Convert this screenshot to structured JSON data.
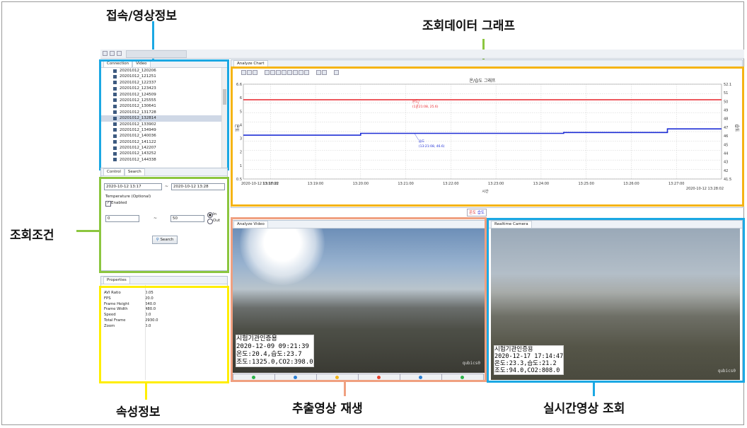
{
  "callouts": {
    "connection": "접속/영상정보",
    "chart": "조회데이터 그래프",
    "conditions": "조회조건",
    "properties": "속성정보",
    "playback": "추출영상 재생",
    "realtime": "실시간영상 조회"
  },
  "colors": {
    "callout_blue": "#1ba8e3",
    "callout_green": "#8cc63f",
    "callout_orange": "#f5b414",
    "callout_yellow": "#ffee00",
    "callout_salmon": "#f0a080",
    "series_temp": "#e8242a",
    "series_humid": "#1f2fd6"
  },
  "connection_panel": {
    "tabs": [
      "Connection",
      "Video"
    ],
    "items": [
      "20201012_120206",
      "20201012_121251",
      "20201012_122337",
      "20201012_123423",
      "20201012_124509",
      "20201012_125555",
      "20201012_130641",
      "20201012_131728",
      "20201012_132814",
      "20201012_133902",
      "20201012_134949",
      "20201012_140036",
      "20201012_141122",
      "20201012_142207",
      "20201012_143252",
      "20201012_144338"
    ],
    "selected_index": 8
  },
  "control_panel": {
    "tabs": [
      "Control",
      "Search"
    ],
    "date_from": "2020-10-12 13:17",
    "date_sep": "~",
    "date_to": "2020-10-12 13:28",
    "temp_label": "Temperature (Optional)",
    "enabled_label": "Enabled",
    "min_value": "0",
    "range_sep": "~",
    "max_value": "50",
    "radio_in": "In",
    "radio_out": "Out",
    "search_label": "Search"
  },
  "properties_panel": {
    "title": "Properties",
    "rows": [
      {
        "key": "AVI Ratio",
        "value": "0.05"
      },
      {
        "key": "FPS",
        "value": "20.0"
      },
      {
        "key": "Frame Height",
        "value": "640.0"
      },
      {
        "key": "Frame Width",
        "value": "480.0"
      },
      {
        "key": "Speed",
        "value": "0.0"
      },
      {
        "key": "Total Frame",
        "value": "2930.0"
      },
      {
        "key": "Zoom",
        "value": "0.0"
      }
    ]
  },
  "chart_panel": {
    "tab": "Analyze Chart"
  },
  "chart_data": {
    "type": "line",
    "title": "온/습도 그래프",
    "x_start_label": "2020-10-12 13:17:22",
    "x_end_label": "2020-10-12 13:28:02",
    "x": [
      "13:18:00",
      "13:19:00",
      "13:20:00",
      "13:21:00",
      "13:22:00",
      "13:23:00",
      "13:24:00",
      "13:25:00",
      "13:26:00",
      "13:27:00"
    ],
    "ylim": [
      0.5,
      6.6
    ],
    "y_ticks": [
      "6.6",
      "6",
      "5",
      "4",
      "3",
      "2",
      "1",
      "0.5"
    ],
    "y2lim": [
      41.5,
      52.1
    ],
    "y2_ticks": [
      "52.1",
      "51",
      "50",
      "49",
      "48",
      "47",
      "46",
      "45",
      "44",
      "43",
      "42",
      "41.5"
    ],
    "ylabel": "온도",
    "y2label": "습도",
    "xlabel": "시간",
    "grid": true,
    "series": [
      {
        "name": "온도",
        "axis": "left",
        "points": [
          [
            0,
            5.6
          ],
          [
            3.7,
            5.6
          ],
          [
            3.7,
            5.6
          ],
          [
            10.6,
            5.6
          ]
        ]
      },
      {
        "name": "습도",
        "axis": "right",
        "points": [
          [
            0,
            46.4
          ],
          [
            2.6,
            46.4
          ],
          [
            2.6,
            46.6
          ],
          [
            7.1,
            46.6
          ],
          [
            7.1,
            46.7
          ],
          [
            9.4,
            46.7
          ],
          [
            9.4,
            47.1
          ],
          [
            10.6,
            47.1
          ]
        ]
      }
    ],
    "annotations": [
      {
        "label": "온도",
        "text": "(13:21:08, 25.6)"
      },
      {
        "label": "습도",
        "text": "(13:21:08, 46.6)"
      }
    ]
  },
  "legend_labels": [
    "온도",
    "습도"
  ],
  "analyze_video": {
    "tab": "Analyze Video",
    "osd": [
      "시험기관인증용",
      "2020-12-09 09:21:39",
      "온도:20.4,습도:23.7",
      "조도:1325.0,CO2:398.0"
    ],
    "watermark": "qubics0"
  },
  "realtime_camera": {
    "tab": "Realtime Camera",
    "osd": [
      "시험기관인증용",
      "2020-12-17 17:14:47",
      "온도:23.3,습도:21.2",
      "조도:94.0,CO2:808.0"
    ],
    "watermark": "qubics0"
  }
}
